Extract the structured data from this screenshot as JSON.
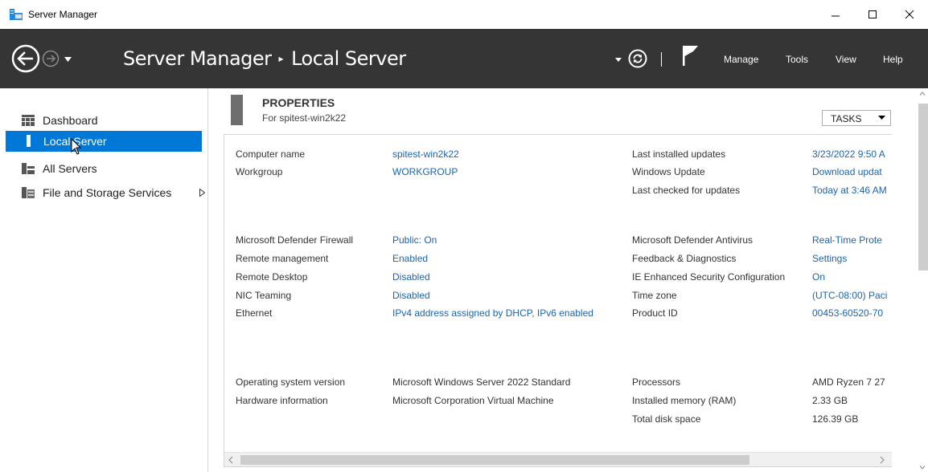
{
  "window": {
    "title": "Server Manager"
  },
  "header": {
    "breadcrumb_root": "Server Manager",
    "breadcrumb_separator": "▸",
    "breadcrumb_current": "Local Server",
    "menu": [
      "Manage",
      "Tools",
      "View",
      "Help"
    ]
  },
  "sidebar": {
    "items": [
      {
        "label": "Dashboard",
        "icon": "dashboard-icon"
      },
      {
        "label": "Local Server",
        "icon": "server-icon",
        "selected": true
      },
      {
        "label": "All Servers",
        "icon": "servers-icon"
      },
      {
        "label": "File and Storage Services",
        "icon": "storage-icon",
        "expandable": true
      }
    ]
  },
  "properties": {
    "title": "PROPERTIES",
    "subtitle": "For spitest-win2k22",
    "tasks_label": "TASKS",
    "groups": [
      {
        "left": [
          {
            "label": "Computer name",
            "value": "spitest-win2k22",
            "link": true
          },
          {
            "label": "Workgroup",
            "value": "WORKGROUP",
            "link": true
          }
        ],
        "right": [
          {
            "label": "Last installed updates",
            "value": "3/23/2022 9:50 A",
            "link": true
          },
          {
            "label": "Windows Update",
            "value": "Download updat",
            "link": true
          },
          {
            "label": "Last checked for updates",
            "value": "Today at 3:46 AM",
            "link": true
          }
        ]
      },
      {
        "left": [
          {
            "label": "Microsoft Defender Firewall",
            "value": "Public: On",
            "link": true
          },
          {
            "label": "Remote management",
            "value": "Enabled",
            "link": true
          },
          {
            "label": "Remote Desktop",
            "value": "Disabled",
            "link": true
          },
          {
            "label": "NIC Teaming",
            "value": "Disabled",
            "link": true
          },
          {
            "label": "Ethernet",
            "value": "IPv4 address assigned by DHCP, IPv6 enabled",
            "link": true
          }
        ],
        "right": [
          {
            "label": "Microsoft Defender Antivirus",
            "value": "Real-Time Prote",
            "link": true
          },
          {
            "label": "Feedback & Diagnostics",
            "value": "Settings",
            "link": true
          },
          {
            "label": "IE Enhanced Security Configuration",
            "value": "On",
            "link": true
          },
          {
            "label": "Time zone",
            "value": "(UTC-08:00) Paci",
            "link": true
          },
          {
            "label": "Product ID",
            "value": "00453-60520-70",
            "link": true
          }
        ]
      },
      {
        "left": [
          {
            "label": "Operating system version",
            "value": "Microsoft Windows Server 2022 Standard",
            "link": false
          },
          {
            "label": "Hardware information",
            "value": "Microsoft Corporation Virtual Machine",
            "link": false
          }
        ],
        "right": [
          {
            "label": "Processors",
            "value": "AMD Ryzen 7 27",
            "link": false
          },
          {
            "label": "Installed memory (RAM)",
            "value": "2.33 GB",
            "link": false
          },
          {
            "label": "Total disk space",
            "value": "126.39 GB",
            "link": false
          }
        ]
      }
    ]
  },
  "colors": {
    "header_bg": "#353535",
    "selection": "#0078d7",
    "link": "#1a64b5"
  }
}
